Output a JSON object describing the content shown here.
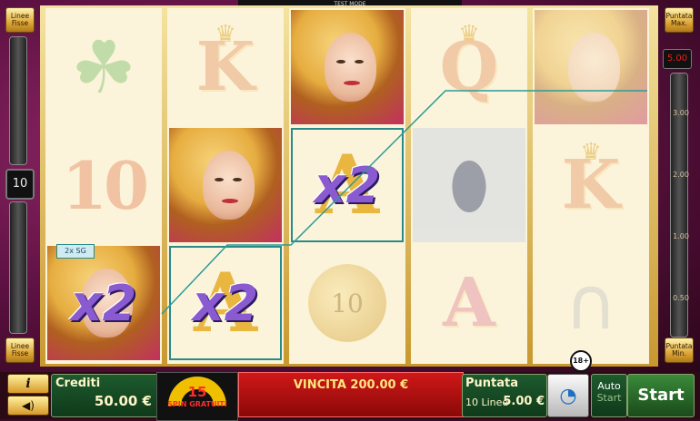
{
  "header": {
    "test_mode": "TEST MODE"
  },
  "left_buttons": {
    "top": "Linee\nFisse",
    "bottom": "Linee\nFisse"
  },
  "right_buttons": {
    "top": "Puntata\nMax.",
    "bottom": "Puntata\nMin."
  },
  "lines_count": "10",
  "bet_scale": {
    "current": "5.00",
    "ticks": [
      "3.00",
      "2.00",
      "1.00",
      "0.50"
    ]
  },
  "sg_tag": "2x SG",
  "age_badge": "18+",
  "reels": [
    [
      "clover",
      "ten",
      "woman-x2"
    ],
    [
      "king",
      "woman",
      "x2"
    ],
    [
      "woman",
      "x2",
      "coin"
    ],
    [
      "queen",
      "diamond",
      "ace"
    ],
    [
      "woman",
      "king",
      "horseshoe"
    ]
  ],
  "symbols": {
    "ten": "10",
    "king": "K",
    "queen": "Q",
    "ace": "A",
    "x2": "x2",
    "coin": "10"
  },
  "bottom_bar": {
    "credits_label": "Crediti",
    "credits_value": "50.00 €",
    "free_spins_count": "15",
    "free_spins_label": "SPIN GRATUITI",
    "win_text": "VINCITA 200.00 €",
    "bet_label": "Puntata",
    "lines_label": "10 Linee",
    "bet_value": "5.00 €",
    "auto_label": "Auto",
    "auto_sub": "Start",
    "start_label": "Start",
    "info_label": "i",
    "sound_label": "◀)"
  },
  "colors": {
    "win_frame": "#2a8a88",
    "win_panel": "#d01818",
    "panel_green": "#1d5a2e"
  }
}
